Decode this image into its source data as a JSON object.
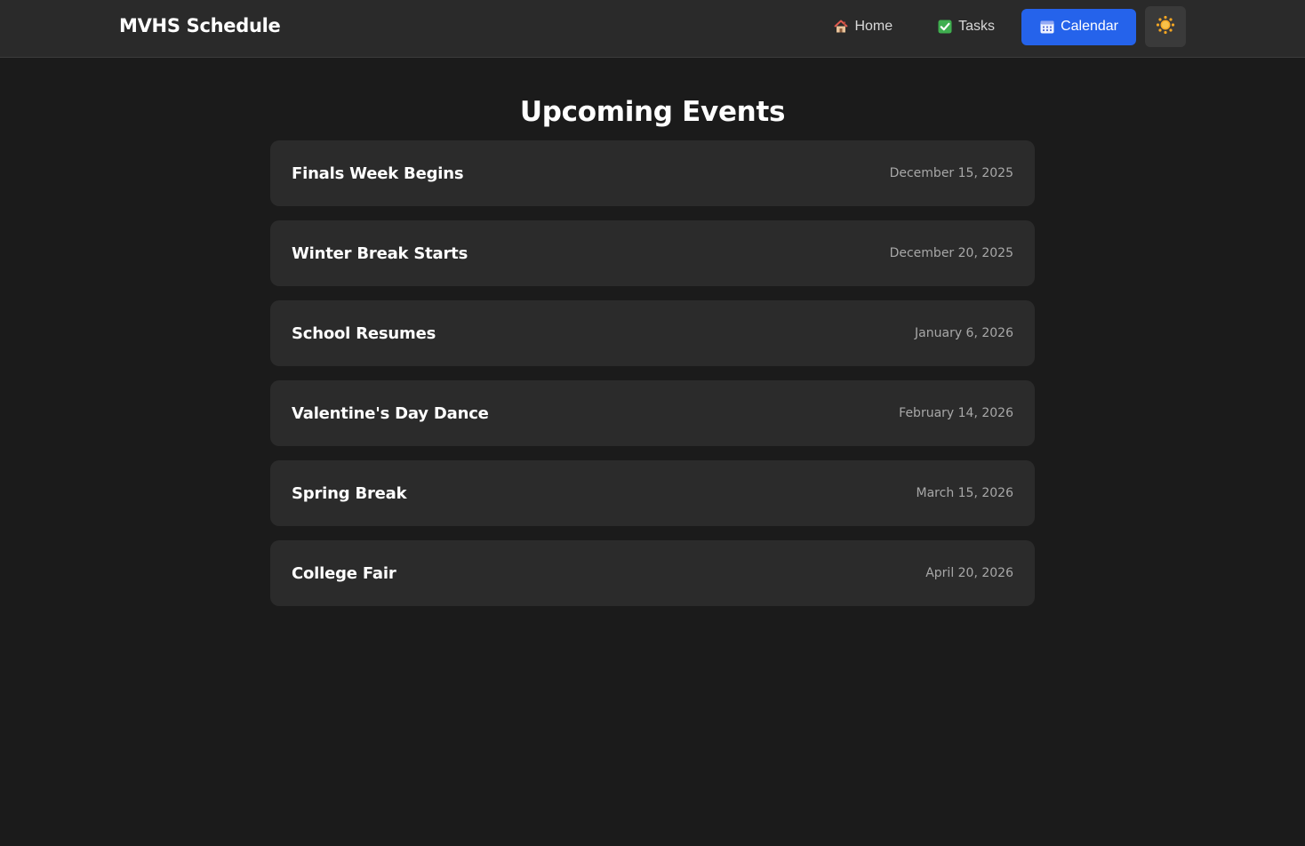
{
  "app": {
    "brand": "MVHS Schedule"
  },
  "nav": {
    "items": [
      {
        "label": "Home",
        "icon": "house-icon"
      },
      {
        "label": "Tasks",
        "icon": "checkbox-icon"
      },
      {
        "label": "Calendar",
        "icon": "calendar-icon",
        "active": true
      }
    ],
    "theme_toggle_icon": "sun-icon"
  },
  "page": {
    "title": "Upcoming Events"
  },
  "events": [
    {
      "name": "Finals Week Begins",
      "date": "December 15, 2025"
    },
    {
      "name": "Winter Break Starts",
      "date": "December 20, 2025"
    },
    {
      "name": "School Resumes",
      "date": "January 6, 2026"
    },
    {
      "name": "Valentine's Day Dance",
      "date": "February 14, 2026"
    },
    {
      "name": "Spring Break",
      "date": "March 15, 2026"
    },
    {
      "name": "College Fair",
      "date": "April 20, 2026"
    }
  ],
  "colors": {
    "background": "#1b1b1b",
    "navbar": "#2a2a2a",
    "card": "#2b2b2b",
    "accent": "#2563eb",
    "muted_text": "#a8a8a8"
  }
}
